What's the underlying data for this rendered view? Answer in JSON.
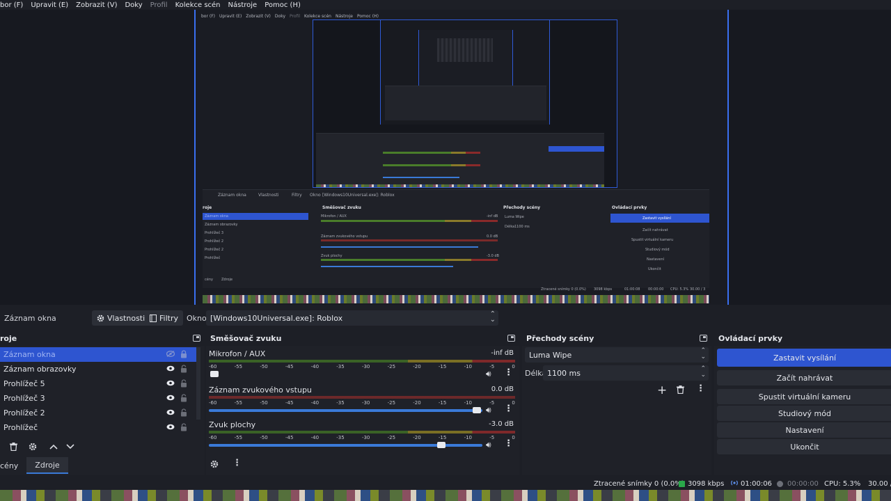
{
  "menu": {
    "items": [
      "bor (F)",
      "Upravit (E)",
      "Zobrazit (V)",
      "Doky",
      "Profil",
      "Kolekce scén",
      "Nástroje",
      "Pomoc (H)"
    ],
    "disabled_index": 4
  },
  "preview": {
    "menu_items": [
      "bor (F)",
      "Upravit (E)",
      "Zobrazit (V)",
      "Doky",
      "Profil",
      "Kolekce scén",
      "Nástroje",
      "Pomoc (H)"
    ],
    "toolbar_source": "Záznam okna",
    "toolbar_props": "Vlastnosti",
    "toolbar_filters": "Filtry",
    "toolbar_window_label": "Okno",
    "toolbar_window_value": "[Windows10Universal.exe]: Roblox",
    "sources_header": "roje",
    "sources": [
      "Záznam okna",
      "Záznam obrazovky",
      "Prohlížeč 3",
      "Prohlížeč 2",
      "Prohlížeč 2",
      "Prohlížeč"
    ],
    "mixer_header": "Směšovač zvuku",
    "mixer_channels": [
      {
        "name": "Mikrofon / AUX",
        "db": "-inf dB"
      },
      {
        "name": "Záznam zvukového vstupu",
        "db": "0.0 dB"
      },
      {
        "name": "Zvuk plochy",
        "db": "-3.0 dB"
      }
    ],
    "transitions_header": "Přechody scény",
    "transition": "Luma Wipe",
    "duration_label": "Délka",
    "duration": "1100 ms",
    "controls_header": "Ovládací prvky",
    "controls": [
      "Zastavit vysílání",
      "Začít nahrávat",
      "Spustit virtuální kameru",
      "Studiový mód",
      "Nastavení",
      "Ukončit"
    ],
    "tabs": [
      "cény",
      "Zdroje"
    ],
    "status": [
      "Ztracené snímky 0 (0.0%)",
      "3098 kbps",
      "01:00:08",
      "00:00:00",
      "CPU: 5.3%",
      "30.00 / 3"
    ]
  },
  "source_toolbar": {
    "source_name": "Záznam okna",
    "properties_label": "Vlastnosti",
    "filters_label": "Filtry",
    "window_label": "Okno",
    "window_value": "[Windows10Universal.exe]: Roblox"
  },
  "sources": {
    "header": "roje",
    "items": [
      {
        "label": "Záznam okna",
        "visible": false,
        "selected": true
      },
      {
        "label": "Záznam obrazovky",
        "visible": true
      },
      {
        "label": "Prohlížeč 5",
        "visible": true
      },
      {
        "label": "Prohlížeč 3",
        "visible": true
      },
      {
        "label": "Prohlížeč 2",
        "visible": true
      },
      {
        "label": "Prohlížeč",
        "visible": true
      }
    ],
    "tabs": [
      "cény",
      "Zdroje"
    ],
    "active_tab": 1
  },
  "mixer": {
    "header": "Směšovač zvuku",
    "scale": [
      "-60",
      "-55",
      "-50",
      "-45",
      "-40",
      "-35",
      "-30",
      "-25",
      "-20",
      "-15",
      "-10",
      "-5",
      "0"
    ],
    "channels": [
      {
        "name": "Mikrofon / AUX",
        "db": "-inf dB",
        "volume": 0.02,
        "meter": "normal"
      },
      {
        "name": "Záznam zvukového vstupu",
        "db": "0.0 dB",
        "volume": 0.98,
        "meter": "red"
      },
      {
        "name": "Zvuk plochy",
        "db": "-3.0 dB",
        "volume": 0.85,
        "meter": "normal"
      }
    ]
  },
  "transitions": {
    "header": "Přechody scény",
    "transition": "Luma Wipe",
    "duration_label": "Délka",
    "duration": "1100 ms"
  },
  "controls": {
    "header": "Ovládací prvky",
    "stop_stream": "Zastavit vysílání",
    "start_recording": "Začít nahrávat",
    "virtual_camera": "Spustit virtuální kameru",
    "studio_mode": "Studiový mód",
    "settings": "Nastavení",
    "exit": "Ukončit"
  },
  "status": {
    "dropped_frames": "Ztracené snímky 0 (0.0%)",
    "bitrate": "3098 kbps",
    "stream_time": "01:00:06",
    "record_time": "00:00:00",
    "cpu": "CPU: 5.3%",
    "fps": "30.00 / 3"
  },
  "colors": {
    "accent": "#2e55d0",
    "slider": "#3a7ad8",
    "bitrate_ok": "#2aa84a",
    "background": "#1d1f26"
  },
  "icons": [
    "gear-icon",
    "filter-icon",
    "eye-icon",
    "eye-off-icon",
    "lock-icon",
    "trash-icon",
    "plus-icon",
    "chevron-up-icon",
    "chevron-down-icon",
    "speaker-icon",
    "more-icon",
    "dock-icon"
  ]
}
